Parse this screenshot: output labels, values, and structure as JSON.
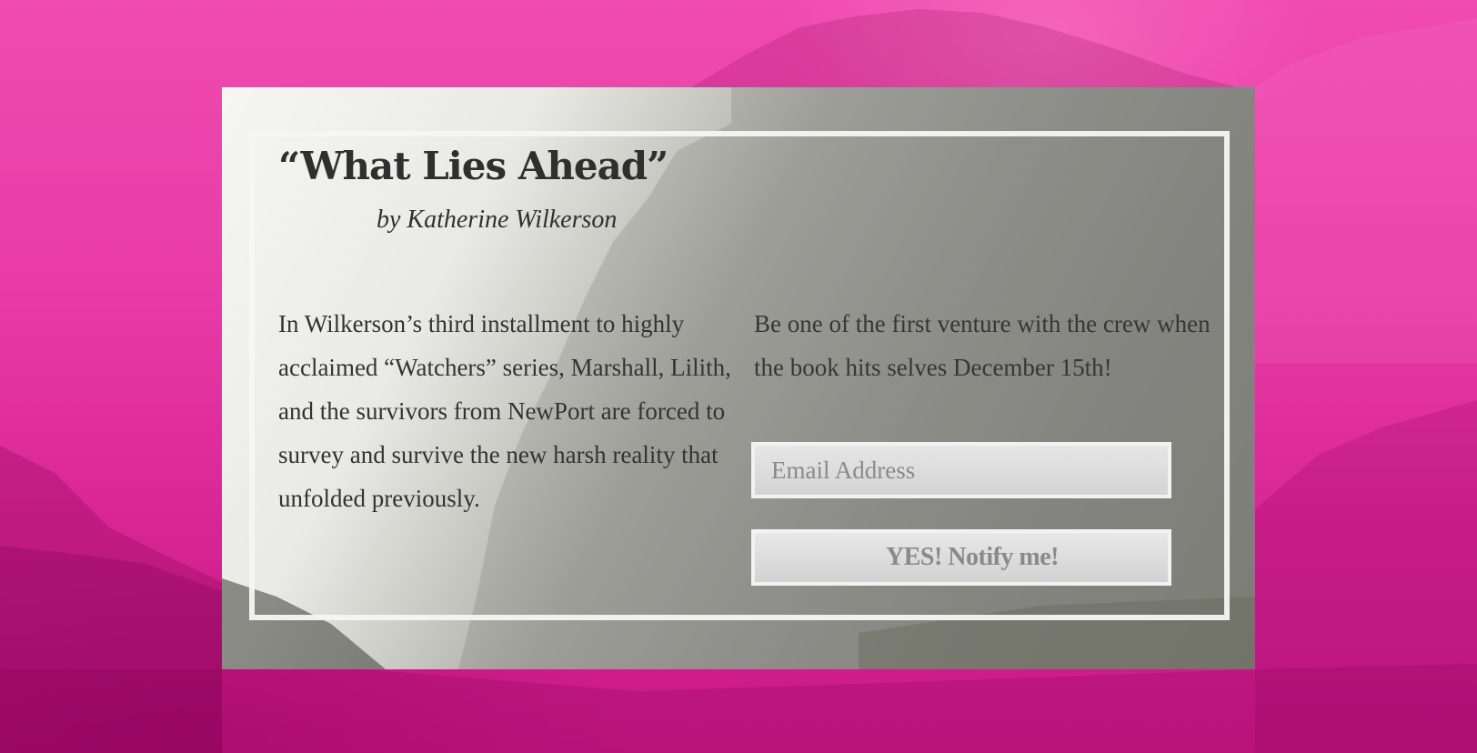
{
  "book": {
    "title": "“What Lies Ahead”",
    "author": "by Katherine Wilkerson",
    "description": "In Wilkerson’s third installment to highly acclaimed “Watchers” series, Marshall, Lilith, and the survivors from NewPort are forced to survey and survive the new harsh reality that unfolded previously."
  },
  "signup": {
    "message": "Be one of the first venture with the crew when the book hits selves December 15th!",
    "email_placeholder": "Email Address",
    "email_value": "",
    "button_label": "YES! Notify me!"
  },
  "colors": {
    "background_accent": "#e83aa6",
    "text": "#333333",
    "frame": "#f5f5f2"
  }
}
